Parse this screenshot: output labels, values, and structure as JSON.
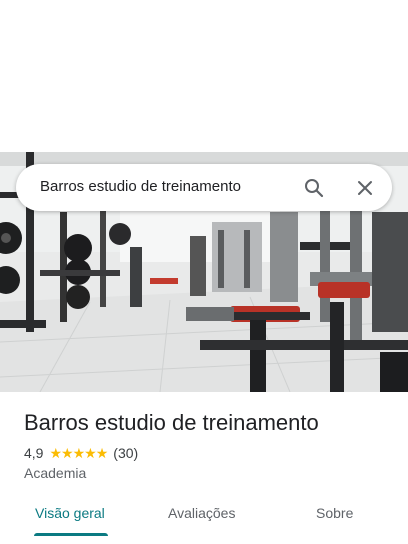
{
  "search": {
    "query": "Barros estudio de treinamento"
  },
  "place": {
    "name": "Barros estudio de treinamento",
    "rating": "4,9",
    "stars": 5,
    "reviews": "(30)",
    "category": "Academia"
  },
  "tabs": [
    {
      "label": "Visão geral",
      "active": true
    },
    {
      "label": "Avaliações",
      "active": false
    },
    {
      "label": "Sobre",
      "active": false
    }
  ],
  "colors": {
    "accent": "#0b7a82",
    "star": "#fbbc04"
  }
}
